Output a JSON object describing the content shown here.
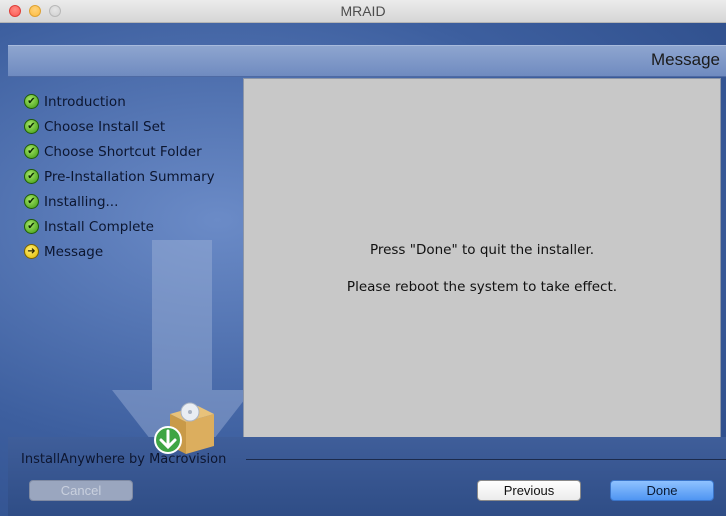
{
  "window": {
    "title": "MRAID"
  },
  "header": {
    "title": "Message"
  },
  "steps": [
    {
      "label": "Introduction",
      "state": "done",
      "icon": "check-circle-icon"
    },
    {
      "label": "Choose Install Set",
      "state": "done",
      "icon": "check-circle-icon"
    },
    {
      "label": "Choose Shortcut Folder",
      "state": "done",
      "icon": "check-circle-icon"
    },
    {
      "label": "Pre-Installation Summary",
      "state": "done",
      "icon": "check-circle-icon"
    },
    {
      "label": "Installing...",
      "state": "done",
      "icon": "check-circle-icon"
    },
    {
      "label": "Install Complete",
      "state": "done",
      "icon": "check-circle-icon"
    },
    {
      "label": "Message",
      "state": "current",
      "icon": "arrow-right-circle-icon"
    }
  ],
  "content": {
    "line1": "Press \"Done\" to quit the installer.",
    "line2": "Please reboot the system to take effect."
  },
  "footer": {
    "vendor": "InstallAnywhere by Macrovision"
  },
  "buttons": {
    "cancel": "Cancel",
    "previous": "Previous",
    "done": "Done"
  },
  "colors": {
    "background": "#3d5f9f",
    "content_panel": "#c8c8c8",
    "done_button": "#5a9cf5",
    "check": "#3c9a12",
    "current": "#e1b800"
  }
}
